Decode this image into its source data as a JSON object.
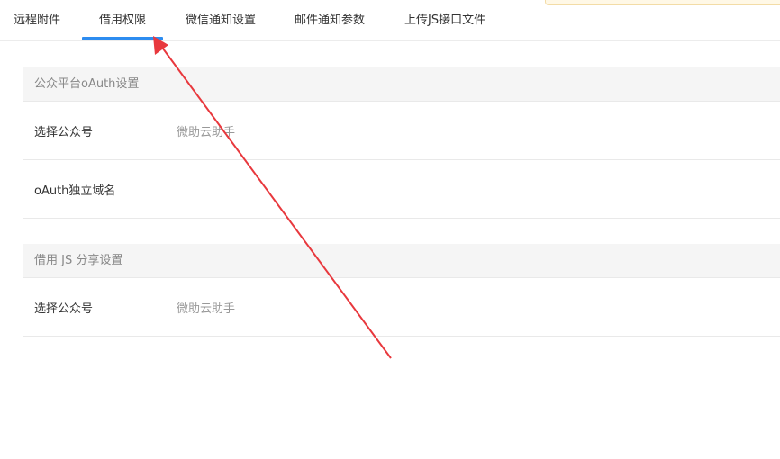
{
  "tabs": [
    {
      "label": "远程附件",
      "active": false
    },
    {
      "label": "借用权限",
      "active": true
    },
    {
      "label": "微信通知设置",
      "active": false
    },
    {
      "label": "邮件通知参数",
      "active": false
    },
    {
      "label": "上传JS接口文件",
      "active": false
    }
  ],
  "sections": {
    "oauth": {
      "title": "公众平台oAuth设置",
      "select_account_label": "选择公众号",
      "select_account_value": "微助云助手",
      "domain_label": "oAuth独立域名",
      "domain_value": ""
    },
    "js_share": {
      "title": "借用 JS 分享设置",
      "select_account_label": "选择公众号",
      "select_account_value": "微助云助手"
    }
  },
  "colors": {
    "active_tab_underline": "#2d8cf0",
    "annotation_arrow": "#e8383d",
    "section_header_bg": "#f5f5f5"
  }
}
